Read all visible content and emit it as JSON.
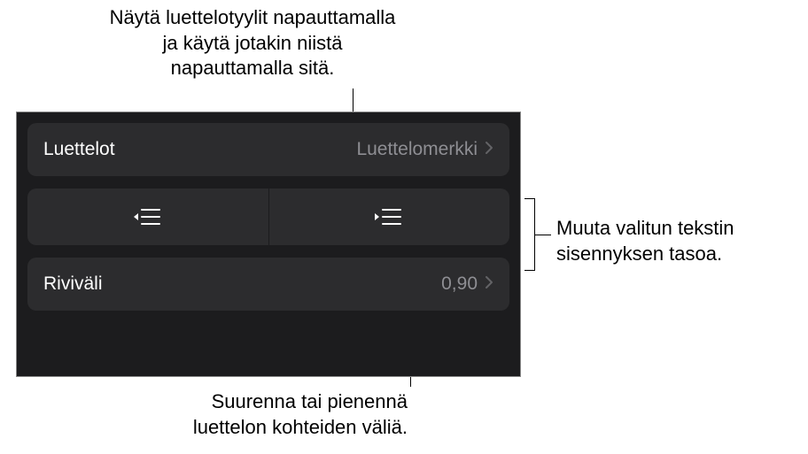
{
  "callouts": {
    "top": "Näytä luettelotyylit napauttamalla\nja käytä jotakin niistä\nnapauttamalla sitä.",
    "right": "Muuta valitun tekstin\nsisennyksen tasoa.",
    "bottom": "Suurenna tai pienennä\nluettelon kohteiden väliä."
  },
  "panel": {
    "lists": {
      "label": "Luettelot",
      "value": "Luettelomerkki"
    },
    "indent": {
      "outdent_name": "outdent-button",
      "indent_name": "indent-button"
    },
    "lineSpacing": {
      "label": "Riviväli",
      "value": "0,90"
    }
  }
}
